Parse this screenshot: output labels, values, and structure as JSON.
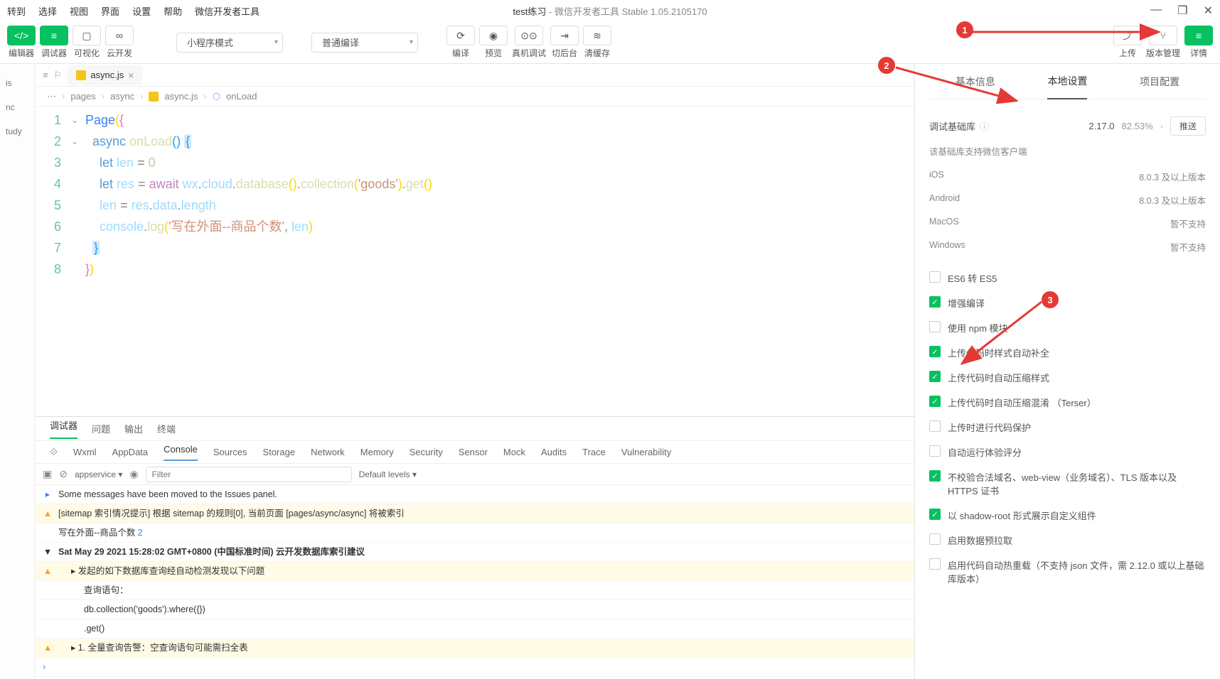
{
  "titlebar": {
    "menus": [
      "转到",
      "选择",
      "视图",
      "界面",
      "设置",
      "帮助",
      "微信开发者工具"
    ],
    "title_project": "test练习",
    "title_suffix": " - 微信开发者工具 Stable 1.05.2105170"
  },
  "toolbar": {
    "items": [
      {
        "label": "编辑器",
        "icon": "</>",
        "green": true
      },
      {
        "label": "调试器",
        "icon": "≡",
        "green": true
      },
      {
        "label": "可视化",
        "icon": "▢"
      },
      {
        "label": "云开发",
        "icon": "∞"
      }
    ],
    "mode_dropdown": "小程序模式",
    "compile_dropdown": "普通编译",
    "actions": [
      {
        "label": "编译",
        "icon": "⟳"
      },
      {
        "label": "预览",
        "icon": "◉"
      },
      {
        "label": "真机调试",
        "icon": "⊙⊙"
      },
      {
        "label": "切后台",
        "icon": "⇥"
      },
      {
        "label": "清缓存",
        "icon": "≋"
      }
    ],
    "right_actions": [
      {
        "label": "上传",
        "icon": "⤴"
      },
      {
        "label": "版本管理",
        "icon": "⑂"
      },
      {
        "label": "详情",
        "icon": "≡",
        "green": true
      }
    ]
  },
  "left_rail": {
    "items": [
      "is",
      "nc",
      "tudy"
    ]
  },
  "editor": {
    "tab_filename": "async.js",
    "breadcrumb": [
      "⋯",
      "pages",
      "async",
      "async.js",
      "onLoad"
    ],
    "code_lines": [
      "Page({",
      "  async onLoad() {",
      "    let len = 0",
      "    let res = await wx.cloud.database().collection('goods').get()",
      "    len = res.data.length",
      "    console.log('写在外面--商品个数', len)",
      "  }",
      "})"
    ]
  },
  "devtools": {
    "tabs1": [
      "调试器",
      "问题",
      "输出",
      "终端"
    ],
    "tabs2": [
      "Wxml",
      "AppData",
      "Console",
      "Sources",
      "Storage",
      "Network",
      "Memory",
      "Security",
      "Sensor",
      "Mock",
      "Audits",
      "Trace",
      "Vulnerability"
    ],
    "filter_context": "appservice",
    "filter_placeholder": "Filter",
    "levels": "Default levels",
    "logs": [
      {
        "type": "info",
        "text": "Some messages have been moved to the Issues panel."
      },
      {
        "type": "warn",
        "text": "[sitemap 索引情况提示] 根据 sitemap 的规则[0], 当前页面 [pages/async/async] 将被索引"
      },
      {
        "type": "plain",
        "text": "写在外面--商品个数",
        "num": "2"
      },
      {
        "type": "group",
        "text": "Sat May 29 2021 15:28:02 GMT+0800 (中国标准时间) 云开发数据库索引建议",
        "bold": true
      },
      {
        "type": "warn",
        "indent": 1,
        "text": "▸ 发起的如下数据库查询经自动检测发现以下问题"
      },
      {
        "type": "plain",
        "indent": 2,
        "text": "查询语句："
      },
      {
        "type": "plain",
        "indent": 2,
        "text": "db.collection('goods').where({})"
      },
      {
        "type": "plain",
        "indent": 2,
        "text": ".get()"
      },
      {
        "type": "warn",
        "indent": 1,
        "text": "▸ 1. 全量查询告警：空查询语句可能需扫全表"
      }
    ],
    "prompt": "›"
  },
  "right_panel": {
    "tabs": [
      "基本信息",
      "本地设置",
      "项目配置"
    ],
    "active_tab": 1,
    "debug_lib_label": "调试基础库",
    "debug_lib_version": "2.17.0",
    "debug_lib_percent": "82.53%",
    "push_btn": "推送",
    "support_note": "该基础库支持微信客户端",
    "platforms": [
      {
        "name": "iOS",
        "value": "8.0.3 及以上版本"
      },
      {
        "name": "Android",
        "value": "8.0.3 及以上版本"
      },
      {
        "name": "MacOS",
        "value": "暂不支持"
      },
      {
        "name": "Windows",
        "value": "暂不支持"
      }
    ],
    "checkboxes": [
      {
        "checked": false,
        "label": "ES6 转 ES5"
      },
      {
        "checked": true,
        "label": "增强编译"
      },
      {
        "checked": false,
        "label": "使用 npm 模块"
      },
      {
        "checked": true,
        "label": "上传代码时样式自动补全"
      },
      {
        "checked": true,
        "label": "上传代码时自动压缩样式"
      },
      {
        "checked": true,
        "label": "上传代码时自动压缩混淆 （Terser）"
      },
      {
        "checked": false,
        "label": "上传时进行代码保护"
      },
      {
        "checked": false,
        "label": "自动运行体验评分"
      },
      {
        "checked": true,
        "label": "不校验合法域名、web-view（业务域名）、TLS 版本以及 HTTPS 证书"
      },
      {
        "checked": true,
        "label": "以 shadow-root 形式展示自定义组件"
      },
      {
        "checked": false,
        "label": "启用数据预拉取"
      },
      {
        "checked": false,
        "label": "启用代码自动热重载（不支持 json 文件，需 2.12.0 或以上基础库版本）"
      }
    ]
  },
  "annotations": {
    "a1": "1",
    "a2": "2",
    "a3": "3"
  }
}
